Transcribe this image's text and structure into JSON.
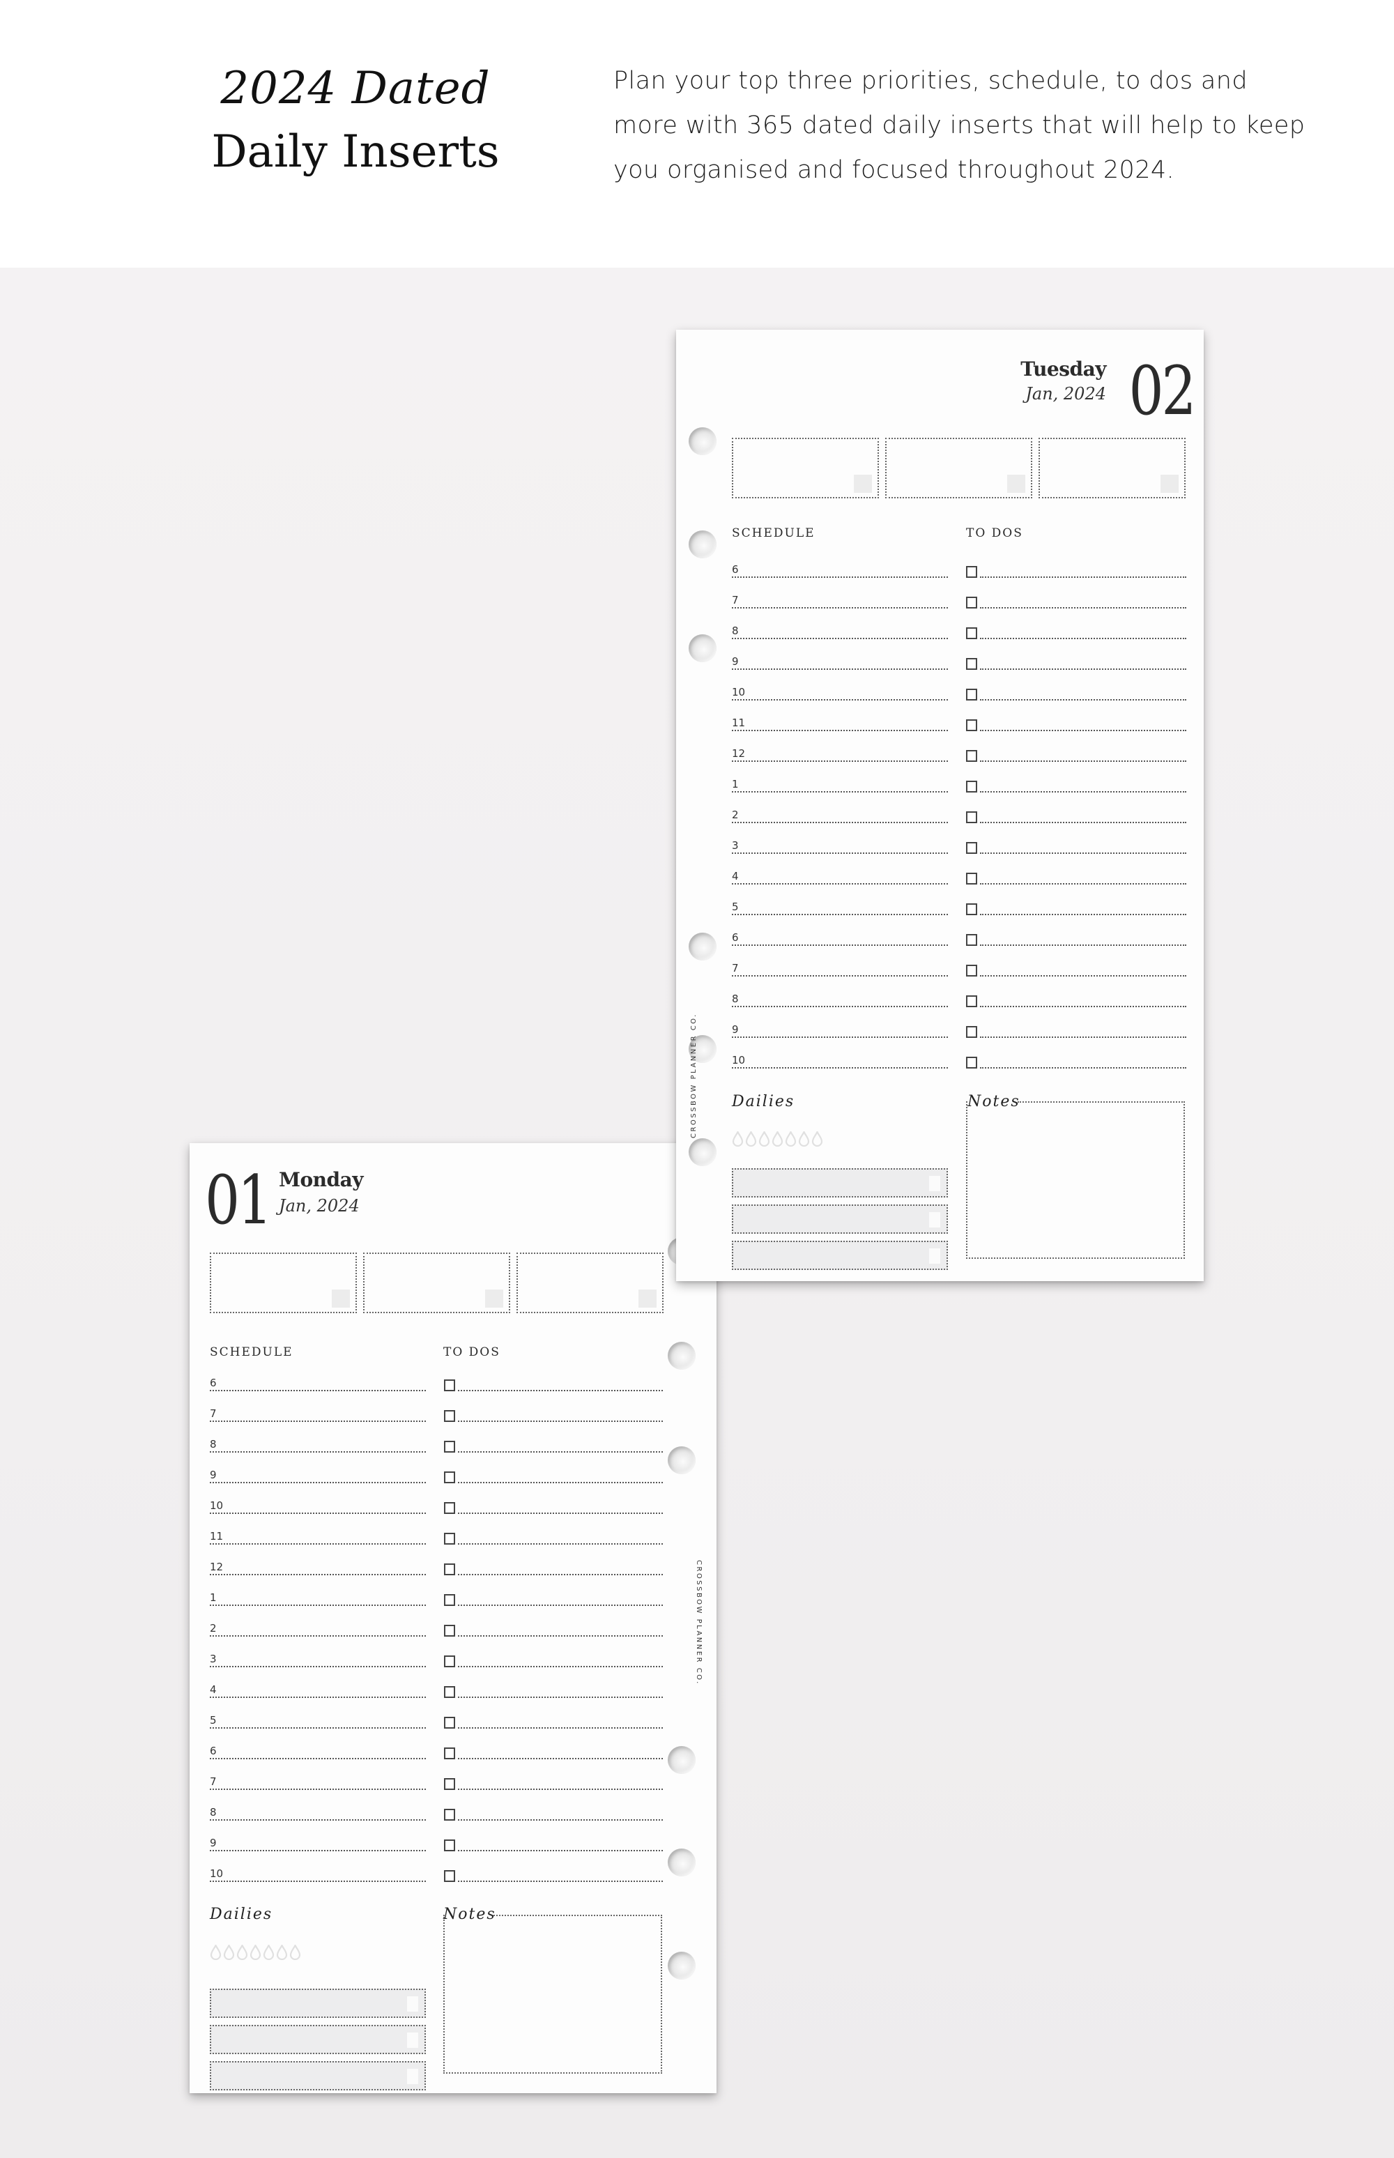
{
  "hero": {
    "title_line1": "2024 Dated",
    "title_line2": "Daily Inserts",
    "description": "Plan your top three priorities, schedule, to dos and more with 365 dated daily inserts that will help to keep you organised and focused throughout 2024."
  },
  "colors": {
    "background_top": "#ffffff",
    "background_stage": "#f4f2f3",
    "paper": "#fdfdfd",
    "ink": "#2b2b2b",
    "fill_gray": "#ececec"
  },
  "pages": {
    "tuesday": {
      "day_number": "02",
      "day_name": "Tuesday",
      "date": "Jan, 2024",
      "brand": "CROSSBOW PLANNER CO.",
      "schedule_label": "SCHEDULE",
      "todos_label": "TO DOS",
      "dailies_label": "Dailies",
      "notes_label": "Notes",
      "priority_count": 3,
      "water_drops": 7,
      "habit_bars": 3,
      "hours": [
        "6",
        "7",
        "8",
        "9",
        "10",
        "11",
        "12",
        "1",
        "2",
        "3",
        "4",
        "5",
        "6",
        "7",
        "8",
        "9",
        "10"
      ]
    },
    "monday": {
      "day_number": "01",
      "day_name": "Monday",
      "date": "Jan, 2024",
      "brand": "CROSSBOW PLANNER CO.",
      "schedule_label": "SCHEDULE",
      "todos_label": "TO DOS",
      "dailies_label": "Dailies",
      "notes_label": "Notes",
      "priority_count": 3,
      "water_drops": 7,
      "habit_bars": 3,
      "hours": [
        "6",
        "7",
        "8",
        "9",
        "10",
        "11",
        "12",
        "1",
        "2",
        "3",
        "4",
        "5",
        "6",
        "7",
        "8",
        "9",
        "10"
      ]
    }
  }
}
